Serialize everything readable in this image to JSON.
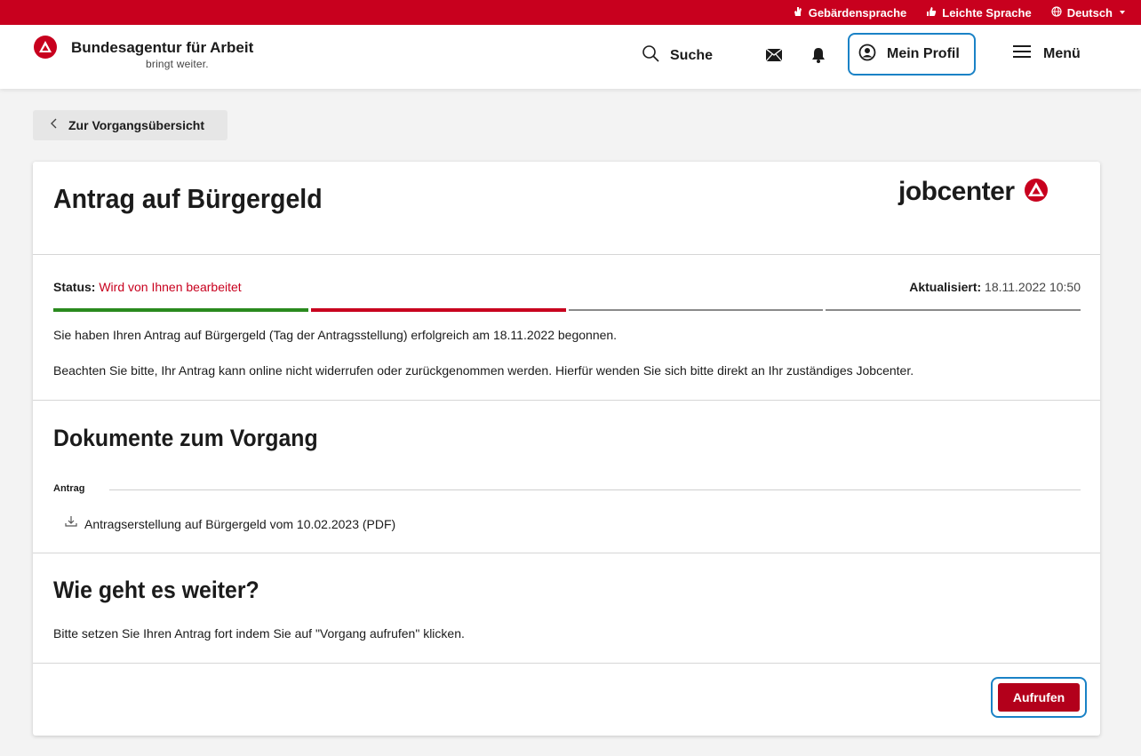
{
  "colors": {
    "brand_red": "#c8001e",
    "status_green": "#2a8a1e",
    "focus_blue": "#1a82c6"
  },
  "topbar": {
    "items": [
      {
        "label": "Gebärdensprache",
        "icon": "hand-icon"
      },
      {
        "label": "Leichte Sprache",
        "icon": "thumbs-up-icon"
      },
      {
        "label": "Deutsch",
        "icon": "globe-icon"
      }
    ]
  },
  "header": {
    "brand_name": "Bundesagentur für Arbeit",
    "brand_tagline": "bringt weiter.",
    "search_label": "Suche",
    "profile_label": "Mein Profil",
    "menu_label": "Menü"
  },
  "back_button": {
    "label": "Zur Vorgangsübersicht"
  },
  "card": {
    "title": "Antrag auf Bürgergeld",
    "jobcenter_logo_text": "jobcenter",
    "status_key": "Status:",
    "status_value": "Wird von Ihnen bearbeitet",
    "updated_key": "Aktualisiert:",
    "updated_value": "18.11.2022 10:50",
    "progress": {
      "total_steps": 4,
      "completed_steps": 1,
      "current_step": 2
    },
    "info_line_1": "Sie haben Ihren Antrag auf Bürgergeld (Tag der Antragsstellung) erfolgreich am 18.11.2022 begonnen.",
    "info_line_2": "Beachten Sie bitte, Ihr Antrag kann online nicht widerrufen oder zurückgenommen werden. Hierfür wenden Sie sich bitte direkt an Ihr zuständiges Jobcenter.",
    "documents_heading": "Dokumente zum Vorgang",
    "documents_group_label": "Antrag",
    "document_link": "Antragserstellung auf Bürgergeld vom 10.02.2023 (PDF)",
    "next_heading": "Wie geht es weiter?",
    "next_text": "Bitte setzen Sie Ihren Antrag fort indem Sie auf \"Vorgang aufrufen\" klicken.",
    "call_button": "Aufrufen"
  }
}
